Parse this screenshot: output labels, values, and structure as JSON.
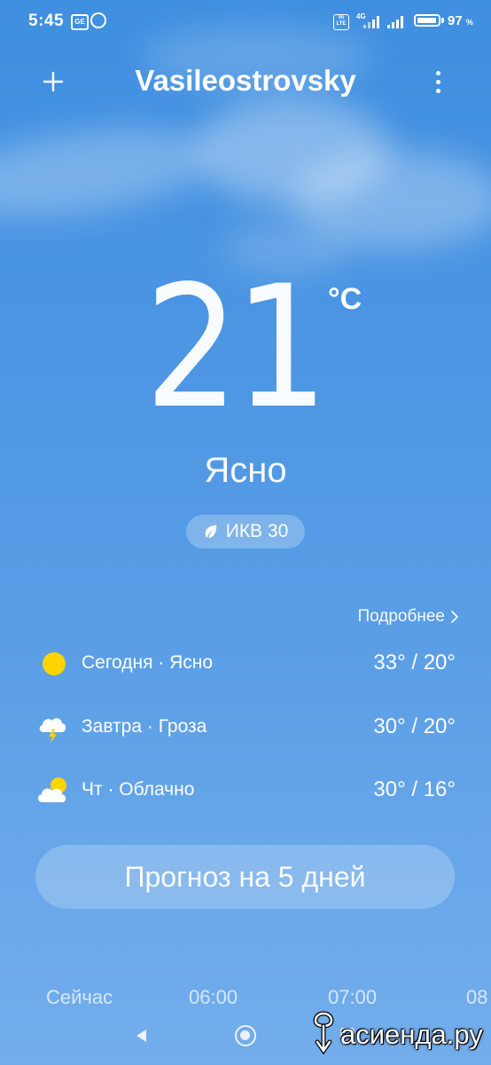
{
  "status_bar": {
    "time": "5:45",
    "ge_icon_text": "GE",
    "volte_text": "Vo LTE",
    "network": "4G",
    "battery_percent": "97",
    "battery_symbol": "%",
    "battery_level": 0.97
  },
  "header": {
    "city": "Vasileostrovsky"
  },
  "current": {
    "temperature": "21",
    "unit": "°C",
    "condition": "Ясно",
    "aqi_label": "ИКВ 30"
  },
  "forecast": {
    "details_label": "Подробнее",
    "days": [
      {
        "label": "Сегодня · Ясно",
        "temps": "33° / 20°",
        "icon": "sun-icon"
      },
      {
        "label": "Завтра · Гроза",
        "temps": "30° / 20°",
        "icon": "thunderstorm-icon"
      },
      {
        "label": "Чт · Облачно",
        "temps": "30° / 16°",
        "icon": "partly-cloudy-icon"
      }
    ],
    "button_label": "Прогноз на 5 дней"
  },
  "hourly": {
    "labels": [
      "Сейчас",
      "06:00",
      "07:00",
      "08"
    ]
  },
  "watermark": {
    "text": "асиенда.ру"
  },
  "colors": {
    "sky_top": "#3f8fe0",
    "sky_bottom": "#73adeb",
    "sun": "#ffd400"
  }
}
